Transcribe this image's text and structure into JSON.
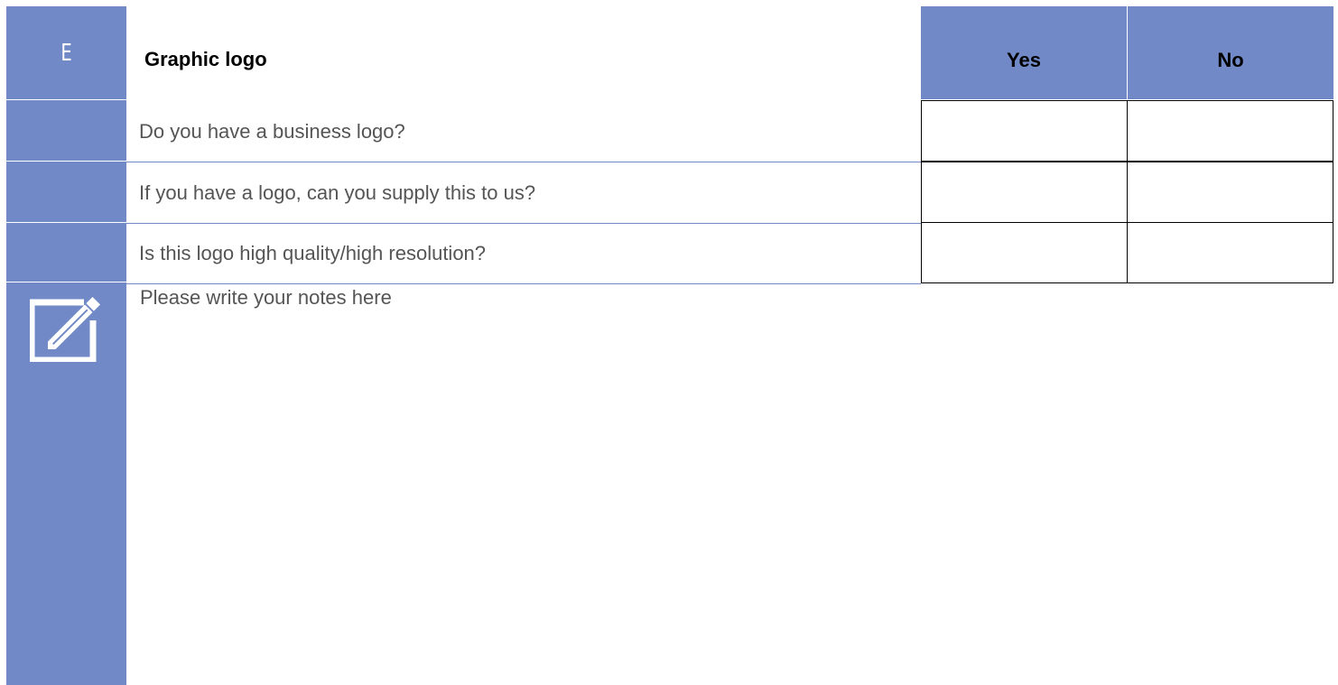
{
  "section": {
    "letter": "E",
    "title": "Graphic logo",
    "columns": {
      "yes": "Yes",
      "no": "No"
    }
  },
  "questions": [
    {
      "text": "Do you have a business logo?",
      "yes": "",
      "no": ""
    },
    {
      "text": "If you have a logo, can you supply this to us?",
      "yes": "",
      "no": ""
    },
    {
      "text": "Is this logo high quality/high resolution?",
      "yes": "",
      "no": ""
    }
  ],
  "notes": {
    "placeholder": "Please write your notes here",
    "icon": "edit-notes-icon"
  },
  "colors": {
    "accent": "#7189c7",
    "body_text": "#555555",
    "heading_text": "#000000"
  }
}
